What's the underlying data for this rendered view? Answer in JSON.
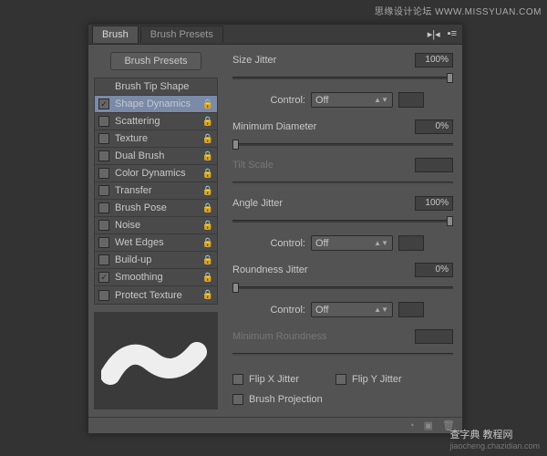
{
  "watermark_top": "思缘设计论坛  WWW.MISSYUAN.COM",
  "watermark_bot": {
    "main": "查字典 教程网",
    "sub": "jiaocheng.chazidian.com"
  },
  "tabs": {
    "active": "Brush",
    "inactive": "Brush Presets"
  },
  "buttons": {
    "presets": "Brush Presets"
  },
  "options": [
    {
      "label": "Brush Tip Shape",
      "cb": "none",
      "lock": false,
      "sel": false
    },
    {
      "label": "Shape Dynamics",
      "cb": "on",
      "lock": true,
      "sel": true
    },
    {
      "label": "Scattering",
      "cb": "off",
      "lock": true,
      "sel": false
    },
    {
      "label": "Texture",
      "cb": "off",
      "lock": true,
      "sel": false
    },
    {
      "label": "Dual Brush",
      "cb": "off",
      "lock": true,
      "sel": false
    },
    {
      "label": "Color Dynamics",
      "cb": "off",
      "lock": true,
      "sel": false
    },
    {
      "label": "Transfer",
      "cb": "off",
      "lock": true,
      "sel": false
    },
    {
      "label": "Brush Pose",
      "cb": "off",
      "lock": true,
      "sel": false
    },
    {
      "label": "Noise",
      "cb": "off",
      "lock": true,
      "sel": false
    },
    {
      "label": "Wet Edges",
      "cb": "off",
      "lock": true,
      "sel": false
    },
    {
      "label": "Build-up",
      "cb": "off",
      "lock": true,
      "sel": false
    },
    {
      "label": "Smoothing",
      "cb": "on",
      "lock": true,
      "sel": false
    },
    {
      "label": "Protect Texture",
      "cb": "off",
      "lock": true,
      "sel": false
    }
  ],
  "sliders": {
    "size_jitter": {
      "label": "Size Jitter",
      "value": "100%",
      "pos": 100,
      "disabled": false
    },
    "min_diam": {
      "label": "Minimum Diameter",
      "value": "0%",
      "pos": 0,
      "disabled": false
    },
    "tilt": {
      "label": "Tilt Scale",
      "value": "",
      "pos": 0,
      "disabled": true
    },
    "angle_jitter": {
      "label": "Angle Jitter",
      "value": "100%",
      "pos": 100,
      "disabled": false
    },
    "round_jitter": {
      "label": "Roundness Jitter",
      "value": "0%",
      "pos": 0,
      "disabled": false
    },
    "min_round": {
      "label": "Minimum Roundness",
      "value": "",
      "pos": 0,
      "disabled": true
    }
  },
  "controls": {
    "label": "Control:",
    "off": "Off"
  },
  "checks": {
    "flipx": "Flip X Jitter",
    "flipy": "Flip Y Jitter",
    "proj": "Brush Projection"
  }
}
